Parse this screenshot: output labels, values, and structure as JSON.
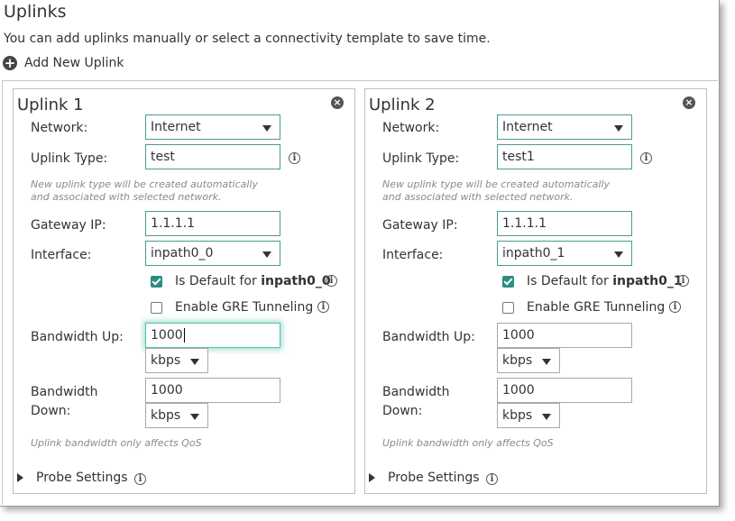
{
  "page": {
    "title": "Uplinks",
    "description": "You can add uplinks manually or select a connectivity template to save time.",
    "add_label": "Add New Uplink"
  },
  "labels": {
    "network": "Network:",
    "uplink_type": "Uplink Type:",
    "type_hint_1": "New uplink type will be created automatically",
    "type_hint_2": "and associated with selected network.",
    "gateway": "Gateway IP:",
    "interface": "Interface:",
    "default_prefix": "Is Default for ",
    "gre": "Enable GRE Tunneling",
    "bw_up": "Bandwidth Up:",
    "bw_down_1": "Bandwidth",
    "bw_down_2": "Down:",
    "bw_hint": "Uplink bandwidth only affects QoS",
    "probe": "Probe Settings"
  },
  "uplinks": [
    {
      "title": "Uplink 1",
      "network": "Internet",
      "uplink_type": "test",
      "gateway_ip": "1.1.1.1",
      "interface": "inpath0_0",
      "default_iface": "inpath0_0",
      "is_default": true,
      "gre_enabled": false,
      "bandwidth_up": "1000",
      "bandwidth_up_unit": "kbps",
      "bandwidth_down": "1000",
      "bandwidth_down_unit": "kbps"
    },
    {
      "title": "Uplink 2",
      "network": "Internet",
      "uplink_type": "test1",
      "gateway_ip": "1.1.1.1",
      "interface": "inpath0_1",
      "default_iface": "inpath0_1",
      "is_default": true,
      "gre_enabled": false,
      "bandwidth_up": "1000",
      "bandwidth_up_unit": "kbps",
      "bandwidth_down": "1000",
      "bandwidth_down_unit": "kbps"
    }
  ],
  "icons": {
    "add": "plus-circle-icon",
    "close": "close-circle-icon",
    "info": "info-icon",
    "dropdown": "caret-down-icon",
    "expand": "caret-right-icon"
  },
  "colors": {
    "field_border": "#4a9a94",
    "checkbox": "#2e8d84",
    "focus_glow": "#56c1ac"
  }
}
